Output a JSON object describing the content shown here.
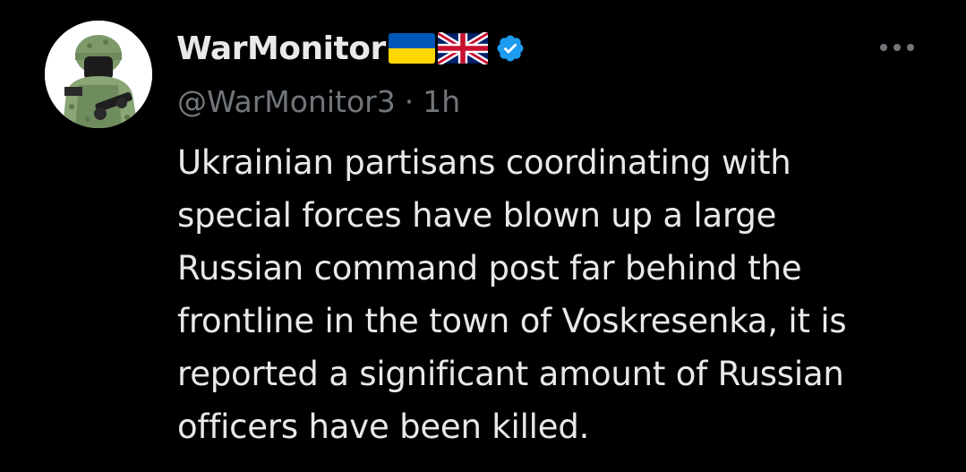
{
  "account": {
    "display_name": "WarMonitor",
    "handle": "@WarMonitor3",
    "separator": "·",
    "time": "1h",
    "flags": [
      "ukraine-flag-icon",
      "uk-flag-icon"
    ],
    "verified_icon": "verified-badge-icon",
    "avatar_icon": "soldier-avatar-icon"
  },
  "menu": {
    "more_icon": "more-options-icon"
  },
  "tweet": {
    "lines": [
      "Ukrainian partisans coordinating with",
      "special forces have blown up a large",
      "Russian command post far behind the",
      "frontline in the town of Voskresenka, it is",
      "reported a significant amount of Russian",
      "officers have been killed."
    ]
  },
  "colors": {
    "background": "#000000",
    "primary_text": "#e7e9ea",
    "secondary_text": "#71767b",
    "verified_blue": "#1d9bf0",
    "ukraine_blue": "#0057b7",
    "ukraine_yellow": "#ffd700"
  }
}
